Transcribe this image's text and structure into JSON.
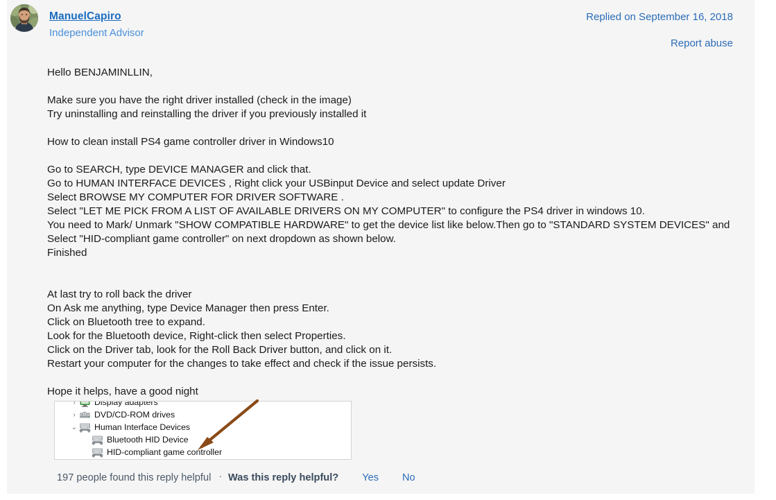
{
  "answer": {
    "author_name": "ManuelCapiro",
    "author_role": "Independent Advisor",
    "replied_on": "Replied on September 16, 2018",
    "report_abuse": "Report abuse"
  },
  "body": {
    "greeting": "Hello BENJAMINLLIN,",
    "para_driver_check": [
      "Make sure you have the right driver installed (check in the image)",
      "Try uninstalling and reinstalling the driver if you previously installed it"
    ],
    "heading_clean_install": "How to clean install PS4 game controller driver in Windows10",
    "steps_clean_install": [
      "Go to SEARCH, type DEVICE MANAGER and click that.",
      "Go to HUMAN INTERFACE DEVICES , Right click your USBinput Device and select update Driver",
      "Select BROWSE MY COMPUTER FOR DRIVER SOFTWARE .",
      "Select \"LET ME PICK FROM A LIST OF AVAILABLE DRIVERS ON MY COMPUTER\" to configure the PS4 driver in windows 10.",
      "You need to Mark/ Unmark \"SHOW COMPATIBLE HARDWARE\" to get the device list like below.Then go to \"STANDARD SYSTEM DEVICES\" and Select \"HID-compliant game controller\" on next dropdown as shown below.",
      "Finished"
    ],
    "steps_roll_back": [
      "At last try to roll back the driver",
      "On Ask me anything, type Device Manager then press Enter.",
      "Click on Bluetooth tree to expand.",
      "Look for the Bluetooth device, Right-click then select Properties.",
      "Click on the Driver tab, look for the Roll Back Driver button, and click on it.",
      "Restart your computer for the changes to take effect and check if the issue persists."
    ],
    "closing": "Hope it helps, have a good night"
  },
  "embedded_image": {
    "alt": "Device Manager tree screenshot",
    "rows": [
      {
        "label": "Display adapters",
        "chevron": "›",
        "icon": "display-adapter-icon",
        "indent": 1
      },
      {
        "label": "DVD/CD-ROM drives",
        "chevron": "›",
        "icon": "dvd-drive-icon",
        "indent": 1
      },
      {
        "label": "Human Interface Devices",
        "chevron": "⌄",
        "icon": "hid-icon",
        "indent": 1
      },
      {
        "label": "Bluetooth HID Device",
        "chevron": "",
        "icon": "hid-icon",
        "indent": 2
      },
      {
        "label": "HID-compliant game controller",
        "chevron": "",
        "icon": "hid-icon",
        "indent": 2
      }
    ],
    "annotation": {
      "name": "arrow-annotation",
      "color": "#8a4a17"
    }
  },
  "footer": {
    "helpful_count": "197 people found this reply helpful",
    "separator": "·",
    "question": "Was this reply helpful?",
    "yes_label": "Yes",
    "no_label": "No"
  },
  "colors": {
    "card_background": "#f5f5f5",
    "link_blue": "#2b6cb8",
    "author_blue": "#1a6bbf",
    "role_blue": "#4a90d9",
    "body_text": "#1b1b1b",
    "arrow_brown": "#8a4a17"
  }
}
